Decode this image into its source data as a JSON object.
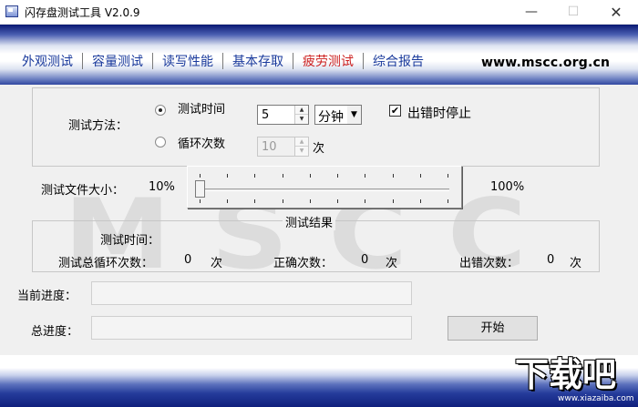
{
  "window": {
    "title": "闪存盘测试工具  V2.0.9",
    "min_glyph": "—",
    "max_glyph": "☐",
    "close_glyph": "✕"
  },
  "nav": {
    "items": [
      {
        "label": "外观测试",
        "active": false
      },
      {
        "label": "容量测试",
        "active": false
      },
      {
        "label": "读写性能",
        "active": false
      },
      {
        "label": "基本存取",
        "active": false
      },
      {
        "label": "疲劳测试",
        "active": true
      },
      {
        "label": "综合报告",
        "active": false
      }
    ],
    "site_url": "www.mscc.org.cn"
  },
  "watermark": {
    "text": "MSCC"
  },
  "method": {
    "label": "测试方法：",
    "option_time": {
      "label": "测试时间",
      "selected": true,
      "value": "5",
      "unit": "分钟"
    },
    "option_loop": {
      "label": "循环次数",
      "selected": false,
      "value": "10",
      "unit": "次"
    },
    "stop_on_error": {
      "label": "出错时停止",
      "checked": true,
      "mark": "✔"
    }
  },
  "file_size": {
    "label": "测试文件大小：",
    "min_label": "10%",
    "max_label": "100%",
    "value_percent": 10
  },
  "results": {
    "title": "测试结果",
    "time_label": "测试时间：",
    "total_loops_label": "测试总循环次数：",
    "total_loops_value": "0",
    "correct_label": "正确次数：",
    "correct_value": "0",
    "error_label": "出错次数：",
    "error_value": "0",
    "unit": "次"
  },
  "progress": {
    "current_label": "当前进度：",
    "total_label": "总进度："
  },
  "start_button": {
    "label": "开始"
  },
  "corner_watermark": {
    "logo": "下载吧",
    "url": "www.xiazaiba.com"
  },
  "colors": {
    "nav_text": "#1a3a9c",
    "nav_active": "#cc2020",
    "band_dark": "#091873"
  }
}
